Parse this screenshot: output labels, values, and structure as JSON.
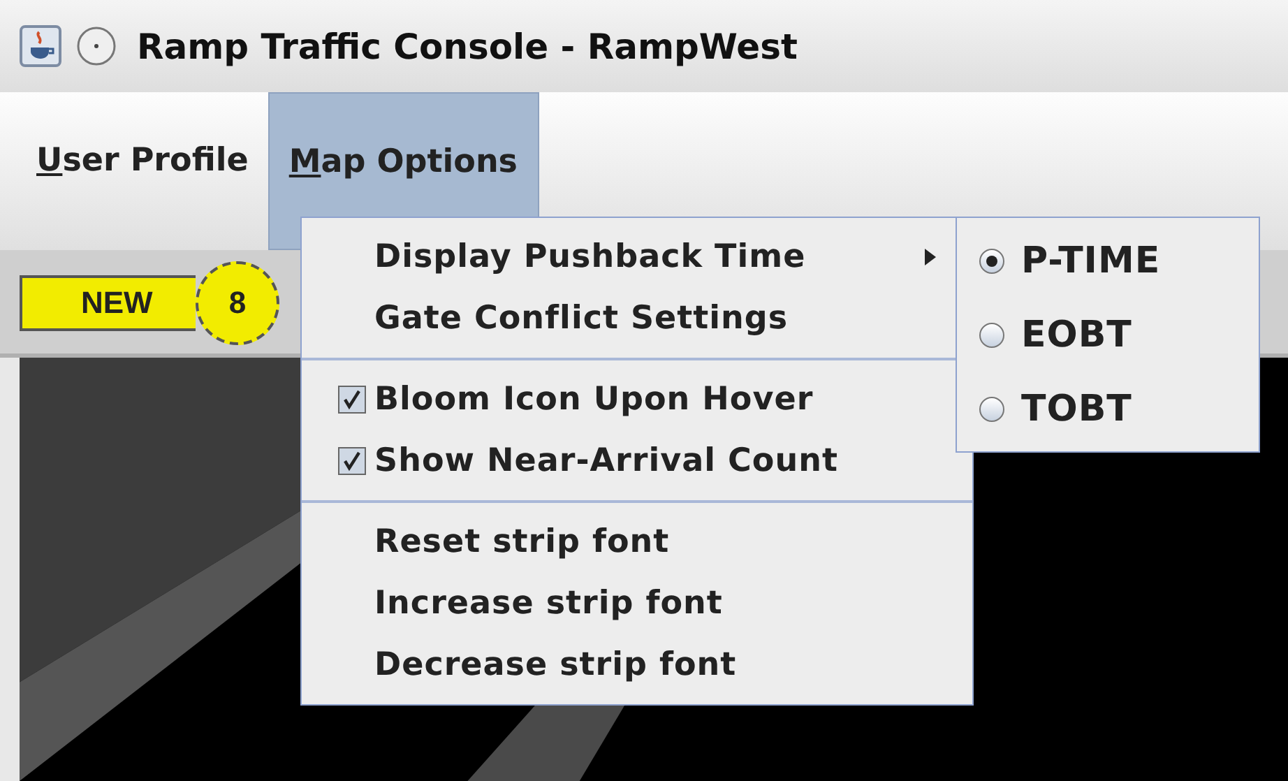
{
  "window": {
    "title": "Ramp Traffic Console - RampWest"
  },
  "menu_bar": [
    {
      "label": "User Profile",
      "selected": false
    },
    {
      "label": "Map Options",
      "selected": true
    }
  ],
  "toolbar": {
    "badge": {
      "label": "NEW",
      "count": "8"
    }
  },
  "dropdown": {
    "groups": [
      [
        {
          "kind": "submenu",
          "label": "Display Pushback Time"
        },
        {
          "kind": "action",
          "label": "Gate Conflict Settings"
        }
      ],
      [
        {
          "kind": "check",
          "label": "Bloom Icon Upon Hover",
          "checked": true
        },
        {
          "kind": "check",
          "label": "Show Near-Arrival Count",
          "checked": true
        }
      ],
      [
        {
          "kind": "action",
          "label": "Reset strip font"
        },
        {
          "kind": "action",
          "label": "Increase strip font"
        },
        {
          "kind": "action",
          "label": "Decrease strip font"
        }
      ]
    ]
  },
  "submenu": [
    {
      "label": "P-TIME",
      "selected": true
    },
    {
      "label": "EOBT",
      "selected": false
    },
    {
      "label": "TOBT",
      "selected": false
    }
  ]
}
